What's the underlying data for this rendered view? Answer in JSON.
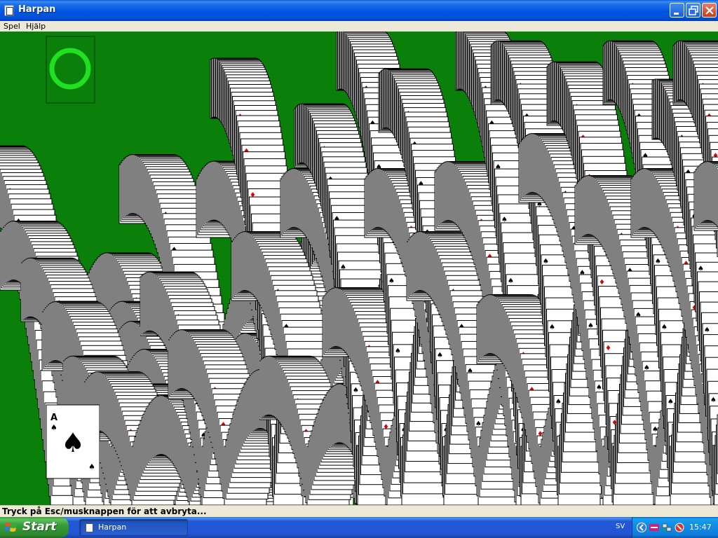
{
  "window": {
    "title": "Harpan",
    "icon": "cards-icon",
    "controls": [
      "minimize-icon",
      "maximize-icon",
      "close-icon"
    ]
  },
  "menu": {
    "items": [
      "Spel",
      "Hjälp"
    ]
  },
  "game": {
    "felt_color": "#0a7f0a",
    "deal_indicator": "ring-icon",
    "visible_card": {
      "rank": "A",
      "suit": "spades"
    }
  },
  "status": {
    "text": "Tryck på Esc/musknappen för att avbryta..."
  },
  "taskbar": {
    "start_label": "Start",
    "task_label": "Harpan",
    "language": "SV",
    "clock": "15:47",
    "tray_icons": [
      "back-arrow-icon",
      "telia-icon",
      "network-icon",
      "security-icon"
    ]
  }
}
